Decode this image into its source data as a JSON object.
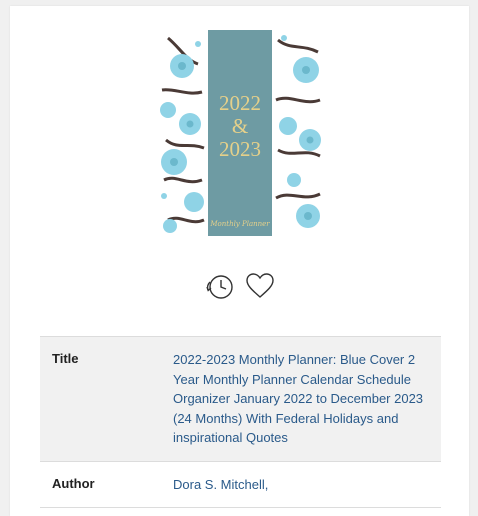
{
  "book": {
    "cover": {
      "year_start": "2022",
      "ampersand": "&",
      "year_end": "2023",
      "script_caption": "Monthly Planner",
      "colors": {
        "band": "#6e9ba3",
        "gold": "#d9c27a",
        "flower": "#8fd3e6",
        "leaf": "#4a3a36"
      }
    },
    "actions": {
      "history_icon": "history-clock-icon",
      "favorite_icon": "heart-icon"
    },
    "details": {
      "title_label": "Title",
      "title_value": "2022-2023 Monthly Planner: Blue Cover 2 Year Monthly Planner Calendar Schedule Organizer January 2022 to December 2023 (24 Months) With Federal Holidays and inspirational Quotes",
      "author_label": "Author",
      "author_value": "Dora S. Mitchell,"
    }
  }
}
